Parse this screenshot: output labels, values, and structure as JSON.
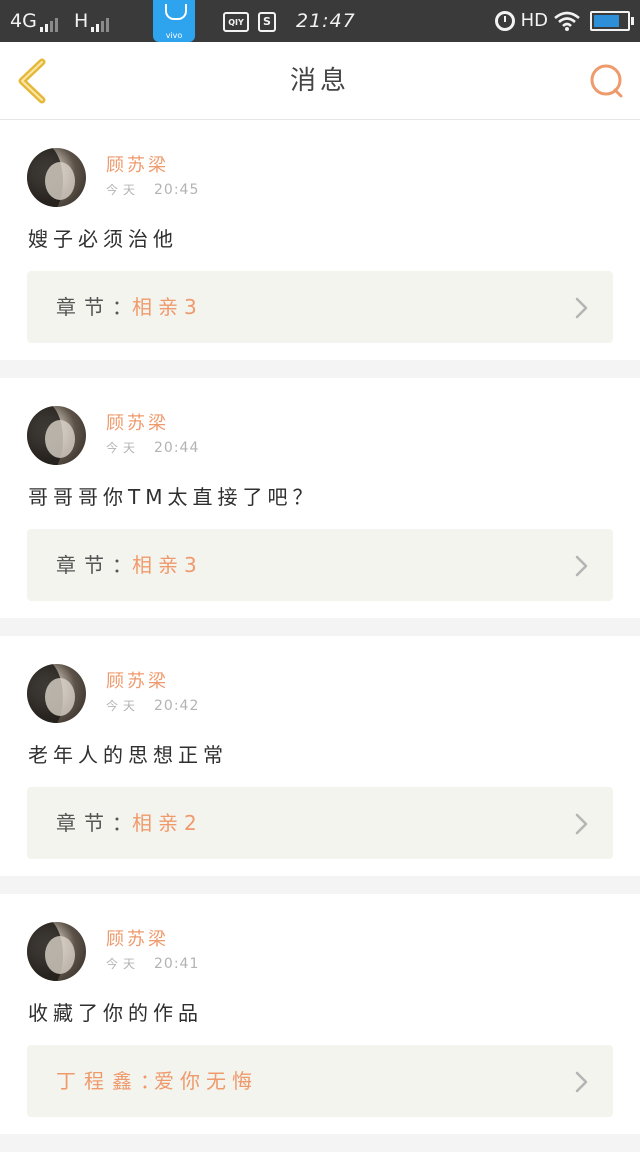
{
  "status_bar": {
    "network_1": "4G",
    "network_2": "H",
    "vivo_label": "vivo",
    "app_icon_1": "QIY",
    "app_icon_2": "S",
    "time": "21:47",
    "hd": "HD",
    "battery_level": 0.78
  },
  "header": {
    "title": "消息",
    "back_icon": "chevron-left-icon",
    "search_icon": "search-icon"
  },
  "colors": {
    "accent": "#ee9a6c",
    "back_chevron": "#e6b83a",
    "status_bar": "#3a3a3a",
    "chapter_box": "#f4f4ef"
  },
  "messages": [
    {
      "user": "顾苏梁",
      "day": "今天",
      "time": "20:45",
      "comment": "嫂子必须治他",
      "chapter_label": "章节：",
      "chapter_value": "相亲3"
    },
    {
      "user": "顾苏梁",
      "day": "今天",
      "time": "20:44",
      "comment": "哥哥哥你TM太直接了吧？",
      "chapter_label": "章节：",
      "chapter_value": "相亲3"
    },
    {
      "user": "顾苏梁",
      "day": "今天",
      "time": "20:42",
      "comment": "老年人的思想正常",
      "chapter_label": "章节：",
      "chapter_value": "相亲2"
    },
    {
      "user": "顾苏梁",
      "day": "今天",
      "time": "20:41",
      "comment": "收藏了你的作品",
      "chapter_label": "丁程鑫：",
      "chapter_value": "爱你无悔"
    }
  ]
}
